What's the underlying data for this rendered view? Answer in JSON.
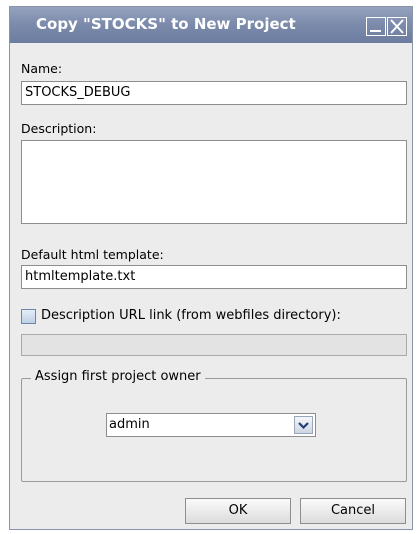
{
  "window": {
    "title": "Copy \"STOCKS\" to New Project",
    "minimize_icon": "minimize-icon",
    "close_icon": "close-icon"
  },
  "form": {
    "name_label": "Name:",
    "name_value": "STOCKS_DEBUG",
    "description_label": "Description:",
    "description_value": "",
    "template_label": "Default html template:",
    "template_value": "htmltemplate.txt",
    "url_checkbox_label": "Description URL link (from webfiles directory):",
    "url_checkbox_checked": false,
    "url_value": ""
  },
  "owner_group": {
    "legend": "Assign first project owner",
    "selected_owner": "admin"
  },
  "buttons": {
    "ok": "OK",
    "cancel": "Cancel"
  }
}
